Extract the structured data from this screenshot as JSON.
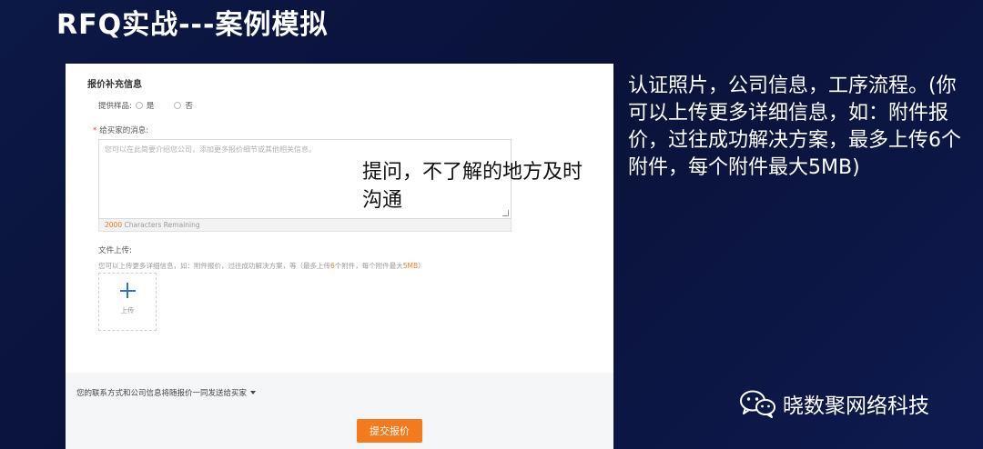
{
  "slide": {
    "title": "RFQ实战---案例模拟",
    "right_text": "认证照片，公司信息，工序流程。(你可以上传更多详细信息，如：附件报价，过往成功解决方案，最多上传6个附件，每个附件最大5MB)",
    "brand": "晓数聚网络科技",
    "overlay_note": "提问，不了解的地方及时沟通"
  },
  "form": {
    "section_title": "报价补充信息",
    "sample_label": "提供样品:",
    "sample_yes": "是",
    "sample_no": "否",
    "message_required_mark": "*",
    "message_label": "给买家的消息:",
    "message_placeholder": "您可以在此简要介绍您公司，添加更多报价细节或其他相关信息。",
    "chars_count": "2000",
    "chars_text": "Characters Remaining",
    "upload_label": "文件上传:",
    "upload_hint_pre": "您可以上传更多详细信息，如：附件报价，过往成功解决方案，等（最多上传",
    "upload_hint_num": "6",
    "upload_hint_mid": "个附件，每个附件最大",
    "upload_hint_size": "5MB",
    "upload_hint_end": "）",
    "upload_button": "上传",
    "contact_note": "您的联系方式和公司信息将随报价一同发送给买家",
    "submit": "提交报价"
  },
  "colors": {
    "accent": "#f37b1d",
    "link": "#2f6fd6",
    "background": "#0c1846"
  }
}
